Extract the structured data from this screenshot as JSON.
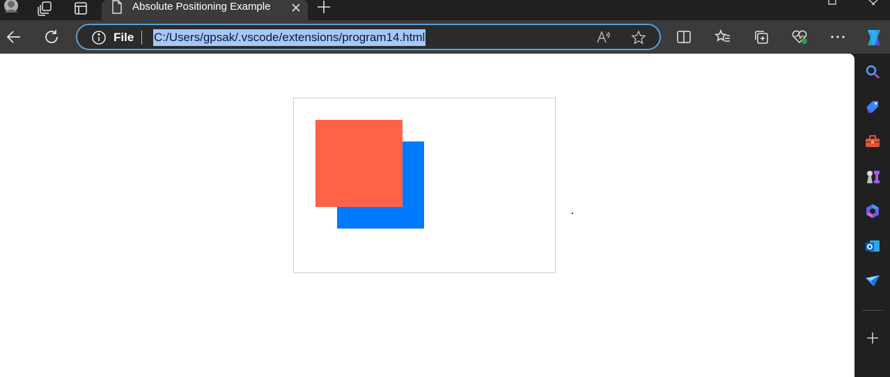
{
  "browser": {
    "tab": {
      "title": "Absolute Positioning Example"
    },
    "address": {
      "scheme_label": "File",
      "url": "C:/Users/gpsak/.vscode/extensions/program14.html"
    }
  },
  "page": {
    "colors": {
      "container_border": "#cccccc",
      "box_front": "#ff6347",
      "box_back": "#007bff",
      "dot": "#7a1a3a"
    }
  },
  "icons": {
    "tabstrip": [
      "profile-icon",
      "workspaces-icon",
      "tab-actions-icon",
      "page-icon",
      "close-icon",
      "new-tab-icon",
      "minimize-icon",
      "close-window-icon"
    ],
    "toolbar": [
      "back-icon",
      "refresh-icon",
      "info-icon",
      "read-aloud-icon",
      "favorite-star-icon",
      "split-screen-icon",
      "favorites-icon",
      "collections-icon",
      "browser-essentials-icon",
      "more-icon",
      "copilot-icon"
    ],
    "sidebar": [
      "search-icon",
      "shopping-icon",
      "tools-icon",
      "games-icon",
      "microsoft-365-icon",
      "outlook-icon",
      "drop-icon",
      "add-icon"
    ]
  }
}
